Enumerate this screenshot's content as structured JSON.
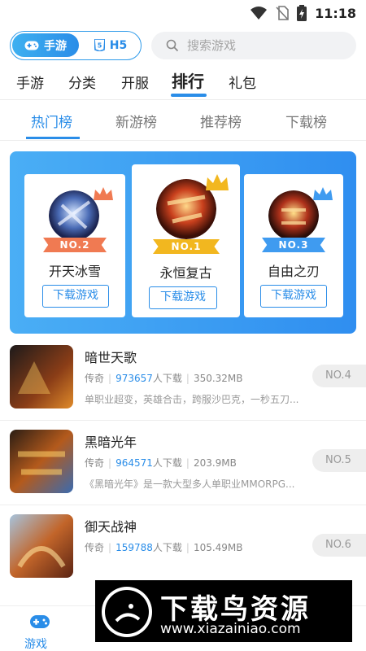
{
  "status_bar": {
    "time": "11:18"
  },
  "header": {
    "mode_tabs": [
      {
        "label": "手游"
      },
      {
        "label": "H5"
      }
    ],
    "search_placeholder": "搜索游戏"
  },
  "main_nav": [
    {
      "label": "手游"
    },
    {
      "label": "分类"
    },
    {
      "label": "开服"
    },
    {
      "label": "排行"
    },
    {
      "label": "礼包"
    }
  ],
  "sub_tabs": [
    {
      "label": "热门榜"
    },
    {
      "label": "新游榜"
    },
    {
      "label": "推荐榜"
    },
    {
      "label": "下载榜"
    }
  ],
  "podium": [
    {
      "rank": "NO.1",
      "name": "永恒复古",
      "button": "下载游戏",
      "color": "#f2b71f"
    },
    {
      "rank": "NO.2",
      "name": "开天冰雪",
      "button": "下载游戏",
      "color": "#f07a52"
    },
    {
      "rank": "NO.3",
      "name": "自由之刃",
      "button": "下载游戏",
      "color": "#3f9bf0"
    }
  ],
  "game_list": [
    {
      "name": "暗世天歌",
      "category": "传奇",
      "downloads": "973657",
      "downloads_suffix": "人下载",
      "size": "350.32MB",
      "desc": "单职业超变，英雄合击，跨服沙巴克，一秒五刀...",
      "rank": "NO.4"
    },
    {
      "name": "黑暗光年",
      "category": "传奇",
      "downloads": "964571",
      "downloads_suffix": "人下载",
      "size": "203.9MB",
      "desc": "《黑暗光年》是一款大型多人单职业MMORPG...",
      "rank": "NO.5"
    },
    {
      "name": "御天战神",
      "category": "传奇",
      "downloads": "159788",
      "downloads_suffix": "人下载",
      "size": "105.49MB",
      "desc": "",
      "rank": "NO.6"
    }
  ],
  "bottom_nav": [
    {
      "label": "游戏"
    }
  ],
  "watermark": {
    "title": "下载鸟资源",
    "url": "www.xiazainiao.com"
  },
  "colors": {
    "accent": "#2a8de8",
    "gold": "#f2b71f",
    "silver": "#f07a52",
    "bronze": "#3f9bf0"
  }
}
